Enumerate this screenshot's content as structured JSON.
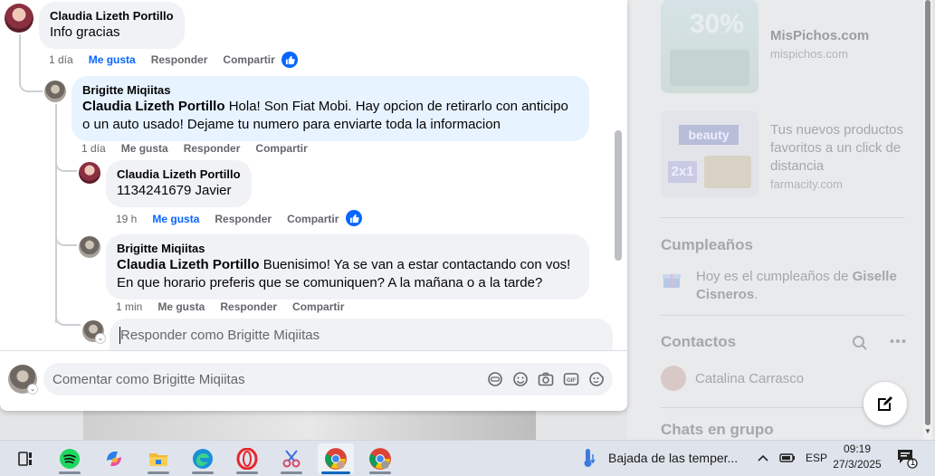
{
  "thread": [
    {
      "author": "Claudia Lizeth Portillo",
      "mention": "",
      "text": "Info gracias",
      "time": "1 día",
      "like_label": "Me gusta",
      "reply_label": "Responder",
      "share_label": "Compartir",
      "liked": true
    },
    {
      "author": "Brigitte Miqiitas",
      "mention": "Claudia Lizeth Portillo",
      "text": "Hola! Son Fiat Mobi. Hay opcion de retirarlo con anticipo o un auto usado! Dejame tu numero para enviarte toda la informacion",
      "time": "1 día",
      "like_label": "Me gusta",
      "reply_label": "Responder",
      "share_label": "Compartir",
      "liked": false
    },
    {
      "author": "Claudia Lizeth Portillo",
      "mention": "",
      "text": "1134241679 Javier",
      "time": "19 h",
      "like_label": "Me gusta",
      "reply_label": "Responder",
      "share_label": "Compartir",
      "liked": true
    },
    {
      "author": "Brigitte Miqiitas",
      "mention": "Claudia Lizeth Portillo",
      "text": "Buenisimo! Ya se van a estar contactando con vos! En que horario preferis que se comuniquen? A la mañana o a la tarde?",
      "time": "1 min",
      "like_label": "Me gusta",
      "reply_label": "Responder",
      "share_label": "Compartir",
      "liked": false
    }
  ],
  "reply_box": {
    "placeholder": "Responder como Brigitte Miqiitas"
  },
  "comment_box": {
    "placeholder": "Comentar como Brigitte Miqiitas"
  },
  "comment_icons": [
    "avatar-sticker-icon",
    "emoji-icon",
    "camera-icon",
    "gif-icon",
    "sticker-icon"
  ],
  "right_rail": {
    "ads": [
      {
        "title": "MisPichos.com",
        "domain": "mispichos.com",
        "image_text": "30%"
      },
      {
        "title": "Tus nuevos productos favoritos a un click de distancia",
        "domain": "farmacity.com",
        "image_text": "beauty",
        "image_text2": "2x1"
      }
    ],
    "birthdays_heading": "Cumpleaños",
    "birthday_prefix": "Hoy es el cumpleaños de ",
    "birthday_name": "Giselle Cisneros",
    "birthday_suffix": ".",
    "contacts_heading": "Contactos",
    "contact_name": "Catalina Carrasco",
    "group_chats_heading": "Chats en grupo"
  },
  "taskbar": {
    "apps": [
      "task-view",
      "spotify",
      "copilot",
      "file-explorer",
      "edge",
      "opera",
      "snipping-tool",
      "chrome",
      "chrome-profile"
    ],
    "active_app": "chrome",
    "weather_text": "Bajada de las temper...",
    "language": "ESP",
    "time": "09:19",
    "date": "27/3/2025",
    "notification_count": "1"
  },
  "colors": {
    "facebook_blue": "#0866ff",
    "bubble_grey": "#f0f2f5",
    "bubble_blue": "#e7f3ff",
    "secondary_text": "#65676b"
  }
}
